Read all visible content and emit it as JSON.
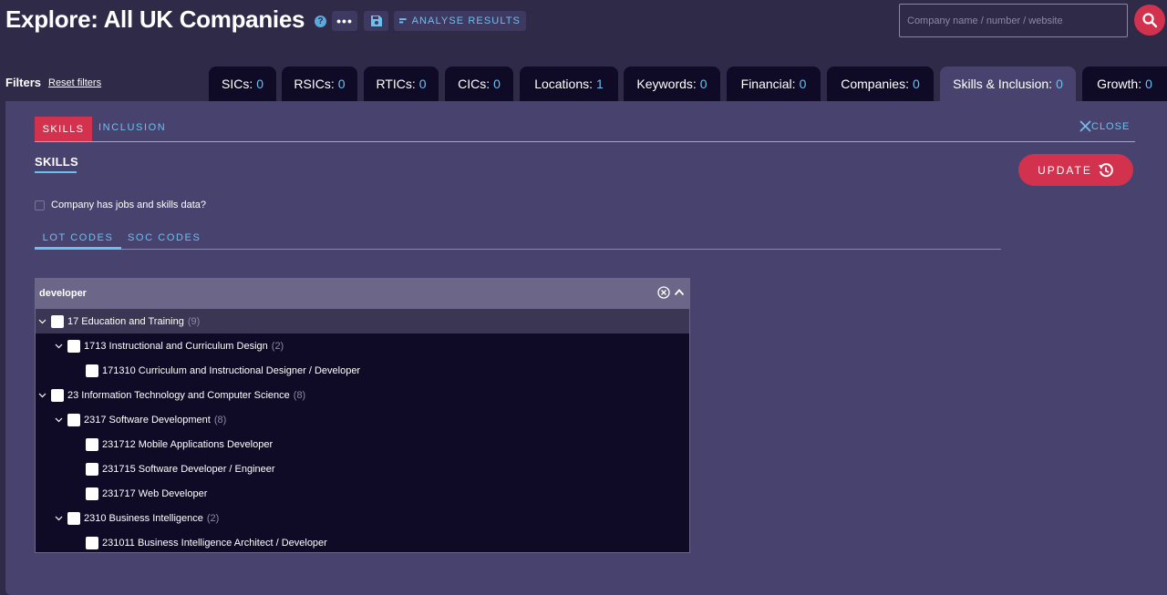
{
  "header": {
    "title": "Explore: All UK Companies",
    "help_icon": "?",
    "more_label": "•••",
    "analyse_label": "ANALYSE RESULTS",
    "search_placeholder": "Company name / number / website"
  },
  "filters": {
    "label": "Filters",
    "reset_label": "Reset filters"
  },
  "tabs": [
    {
      "label": "SICs:",
      "count": "0"
    },
    {
      "label": "RSICs:",
      "count": "0"
    },
    {
      "label": "RTICs:",
      "count": "0"
    },
    {
      "label": "CICs:",
      "count": "0"
    },
    {
      "label": "Locations:",
      "count": "1"
    },
    {
      "label": "Keywords:",
      "count": "0"
    },
    {
      "label": "Financial:",
      "count": "0"
    },
    {
      "label": "Companies:",
      "count": "0"
    },
    {
      "label": "Skills & Inclusion:",
      "count": "0"
    },
    {
      "label": "Growth:",
      "count": "0"
    }
  ],
  "active_tab": "Skills & Inclusion:",
  "subtabs": {
    "skills": "SKILLS",
    "inclusion": "INCLUSION"
  },
  "close_label": "CLOSE",
  "section": {
    "heading": "SKILLS",
    "update_label": "UPDATE"
  },
  "jobs_checkbox": {
    "label": "Company has jobs and skills data?",
    "checked": false
  },
  "code_tabs": {
    "lot": "LOT CODES",
    "soc": "SOC CODES"
  },
  "dropdown": {
    "value": "developer",
    "items": [
      {
        "level": 0,
        "name": "17 Education and Training",
        "count": "(9)",
        "expandable": true
      },
      {
        "level": 1,
        "name": "1713 Instructional and Curriculum Design",
        "count": "(2)",
        "expandable": true
      },
      {
        "level": 2,
        "name": "171310 Curriculum and Instructional Designer / Developer",
        "count": "",
        "expandable": false
      },
      {
        "level": 0,
        "name": "23 Information Technology and Computer Science",
        "count": "(8)",
        "expandable": true
      },
      {
        "level": 1,
        "name": "2317 Software Development",
        "count": "(8)",
        "expandable": true
      },
      {
        "level": 2,
        "name": "231712 Mobile Applications Developer",
        "count": "",
        "expandable": false
      },
      {
        "level": 2,
        "name": "231715 Software Developer / Engineer",
        "count": "",
        "expandable": false
      },
      {
        "level": 2,
        "name": "231717 Web Developer",
        "count": "",
        "expandable": false
      },
      {
        "level": 1,
        "name": "2310 Business Intelligence",
        "count": "(2)",
        "expandable": true
      },
      {
        "level": 2,
        "name": "231011 Business Intelligence Architect / Developer",
        "count": "",
        "expandable": false
      }
    ]
  },
  "colors": {
    "accent": "#d2324e",
    "link": "#6bc0ee",
    "panel": "#48426f",
    "background": "#2e2a47"
  }
}
